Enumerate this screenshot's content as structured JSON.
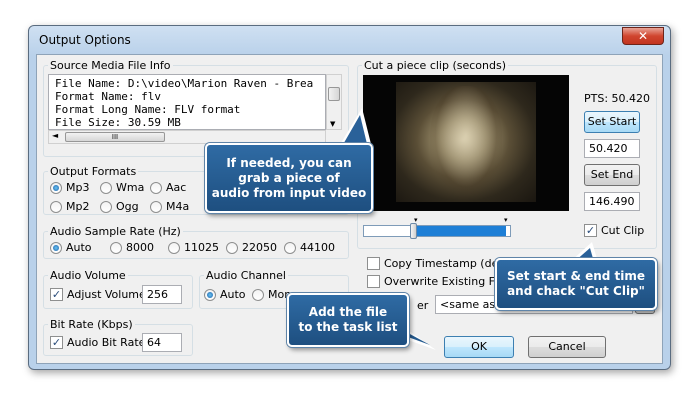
{
  "window": {
    "title": "Output Options",
    "close_label": "✕"
  },
  "source_info": {
    "legend": "Source Media File Info",
    "lines": [
      "File Name: D:\\video\\Marion Raven - Brea",
      "Format Name: flv",
      "Format Long Name: FLV format",
      "File Size: 30.59 MB"
    ],
    "hscroll_thumb": "III"
  },
  "output_formats": {
    "legend": "Output Formats",
    "options": [
      "Mp3",
      "Wma",
      "Aac",
      "Mp2",
      "Ogg",
      "M4a"
    ],
    "selected": "Mp3"
  },
  "sample_rate": {
    "legend": "Audio Sample Rate (Hz)",
    "options": [
      "Auto",
      "8000",
      "11025",
      "22050",
      "44100"
    ],
    "selected": "Auto"
  },
  "audio_volume": {
    "legend": "Audio Volume",
    "checkbox_label": "Adjust Volume",
    "checked": true,
    "value": "256"
  },
  "audio_channel": {
    "legend": "Audio Channel",
    "options": [
      "Auto",
      "Mon"
    ],
    "selected": "Auto"
  },
  "bit_rate": {
    "legend": "Bit Rate (Kbps)",
    "checkbox_label": "Audio Bit Rate",
    "checked": true,
    "value": "64"
  },
  "clip": {
    "legend": "Cut a piece clip (seconds)",
    "pts_label": "PTS: 50.420",
    "set_start_label": "Set Start",
    "start_value": "50.420",
    "set_end_label": "Set End",
    "end_value": "146.490",
    "cut_clip_label": "Cut Clip",
    "cut_clip_checked": true,
    "slider_fraction": 0.34
  },
  "options": {
    "copy_timestamp_label": "Copy Timestamp (decodin",
    "overwrite_label": "Overwrite Existing File",
    "folder_label_fragment": "er",
    "folder_value": "<same as inpu",
    "browse_label": "..."
  },
  "buttons": {
    "ok_label": "OK",
    "cancel_label": "Cancel"
  },
  "callouts": {
    "grab_audio": "If needed, you can\ngrab a piece of\naudio from input video",
    "set_times": "Set start & end time\nand chack \"Cut Clip\"",
    "add_file": "Add the file\nto the task list"
  },
  "colors": {
    "accent": "#1e4f80",
    "titlebar": "#b9d1ea",
    "progress": "#1e7fd6"
  }
}
